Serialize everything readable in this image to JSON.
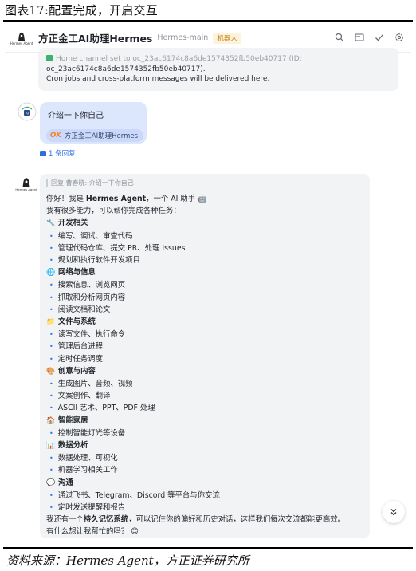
{
  "figure": {
    "caption": "图表17:配置完成，开启交互",
    "source": "资料来源：Hermes Agent，方正证券研究所"
  },
  "header": {
    "logo_text": "Hermes Agent",
    "bot_name": "方正金工AI助理Hermes",
    "channel": "Hermes-main",
    "tag": "机器人",
    "icons": [
      "search-icon",
      "window-icon",
      "check-icon",
      "settings-icon"
    ]
  },
  "system_message": {
    "line1": "Home channel set to oc_23ac6174c8a6de1574352fb50eb40717 (ID:",
    "line2": "oc_23ac6174c8a6de1574352fb50eb40717).",
    "line3": "Cron jobs and cross-platform messages will be delivered here.",
    "cron_word": "Cron"
  },
  "user_message": {
    "text": "介绍一下你自己",
    "chip_badge": "OK",
    "chip_label": "方正金工AI助理Hermes",
    "reply_count": "1 条回复"
  },
  "bot_reply": {
    "quote": "回复 曹春晓: 介绍一下你自己",
    "intro_prefix": "你好！我是 ",
    "intro_name": "Hermes Agent",
    "intro_suffix": "，一个 AI 助手 🤖",
    "subtitle": "我有很多能力，可以帮你完成各种任务：",
    "sections": [
      {
        "emoji": "🔧",
        "title": "开发相关",
        "items": [
          "编写、调试、审查代码",
          "管理代码仓库、提交 PR、处理 Issues",
          "规划和执行软件开发项目"
        ]
      },
      {
        "emoji": "🌐",
        "title": "网络与信息",
        "items": [
          "搜索信息、浏览网页",
          "抓取和分析网页内容",
          "阅读文档和论文"
        ]
      },
      {
        "emoji": "📁",
        "title": "文件与系统",
        "items": [
          "读写文件、执行命令",
          "管理后台进程",
          "定时任务调度"
        ]
      },
      {
        "emoji": "🎨",
        "title": "创意与内容",
        "items": [
          "生成图片、音频、视频",
          "文案创作、翻译",
          "ASCII 艺术、PPT、PDF 处理"
        ]
      },
      {
        "emoji": "🏠",
        "title": "智能家居",
        "items": [
          "控制智能灯光等设备"
        ]
      },
      {
        "emoji": "📊",
        "title": "数据分析",
        "items": [
          "数据处理、可视化",
          "机器学习相关工作"
        ]
      },
      {
        "emoji": "💬",
        "title": "沟通",
        "items": [
          "通过飞书、Telegram、Discord 等平台与你交流",
          "定时发送提醒和报告"
        ]
      }
    ],
    "outro_prefix": "我还有一个",
    "outro_bold": "持久记忆系统",
    "outro_suffix": "，可以记住你的偏好和历史对话，这样我们每次交流都能更高效。",
    "closing": "有什么想让我帮忙的吗？ 😊"
  },
  "colors": {
    "accent": "#3370ff",
    "user_bubble": "#dce7fd",
    "bot_bubble": "#f2f3f5",
    "tag_text": "#c7800d"
  }
}
